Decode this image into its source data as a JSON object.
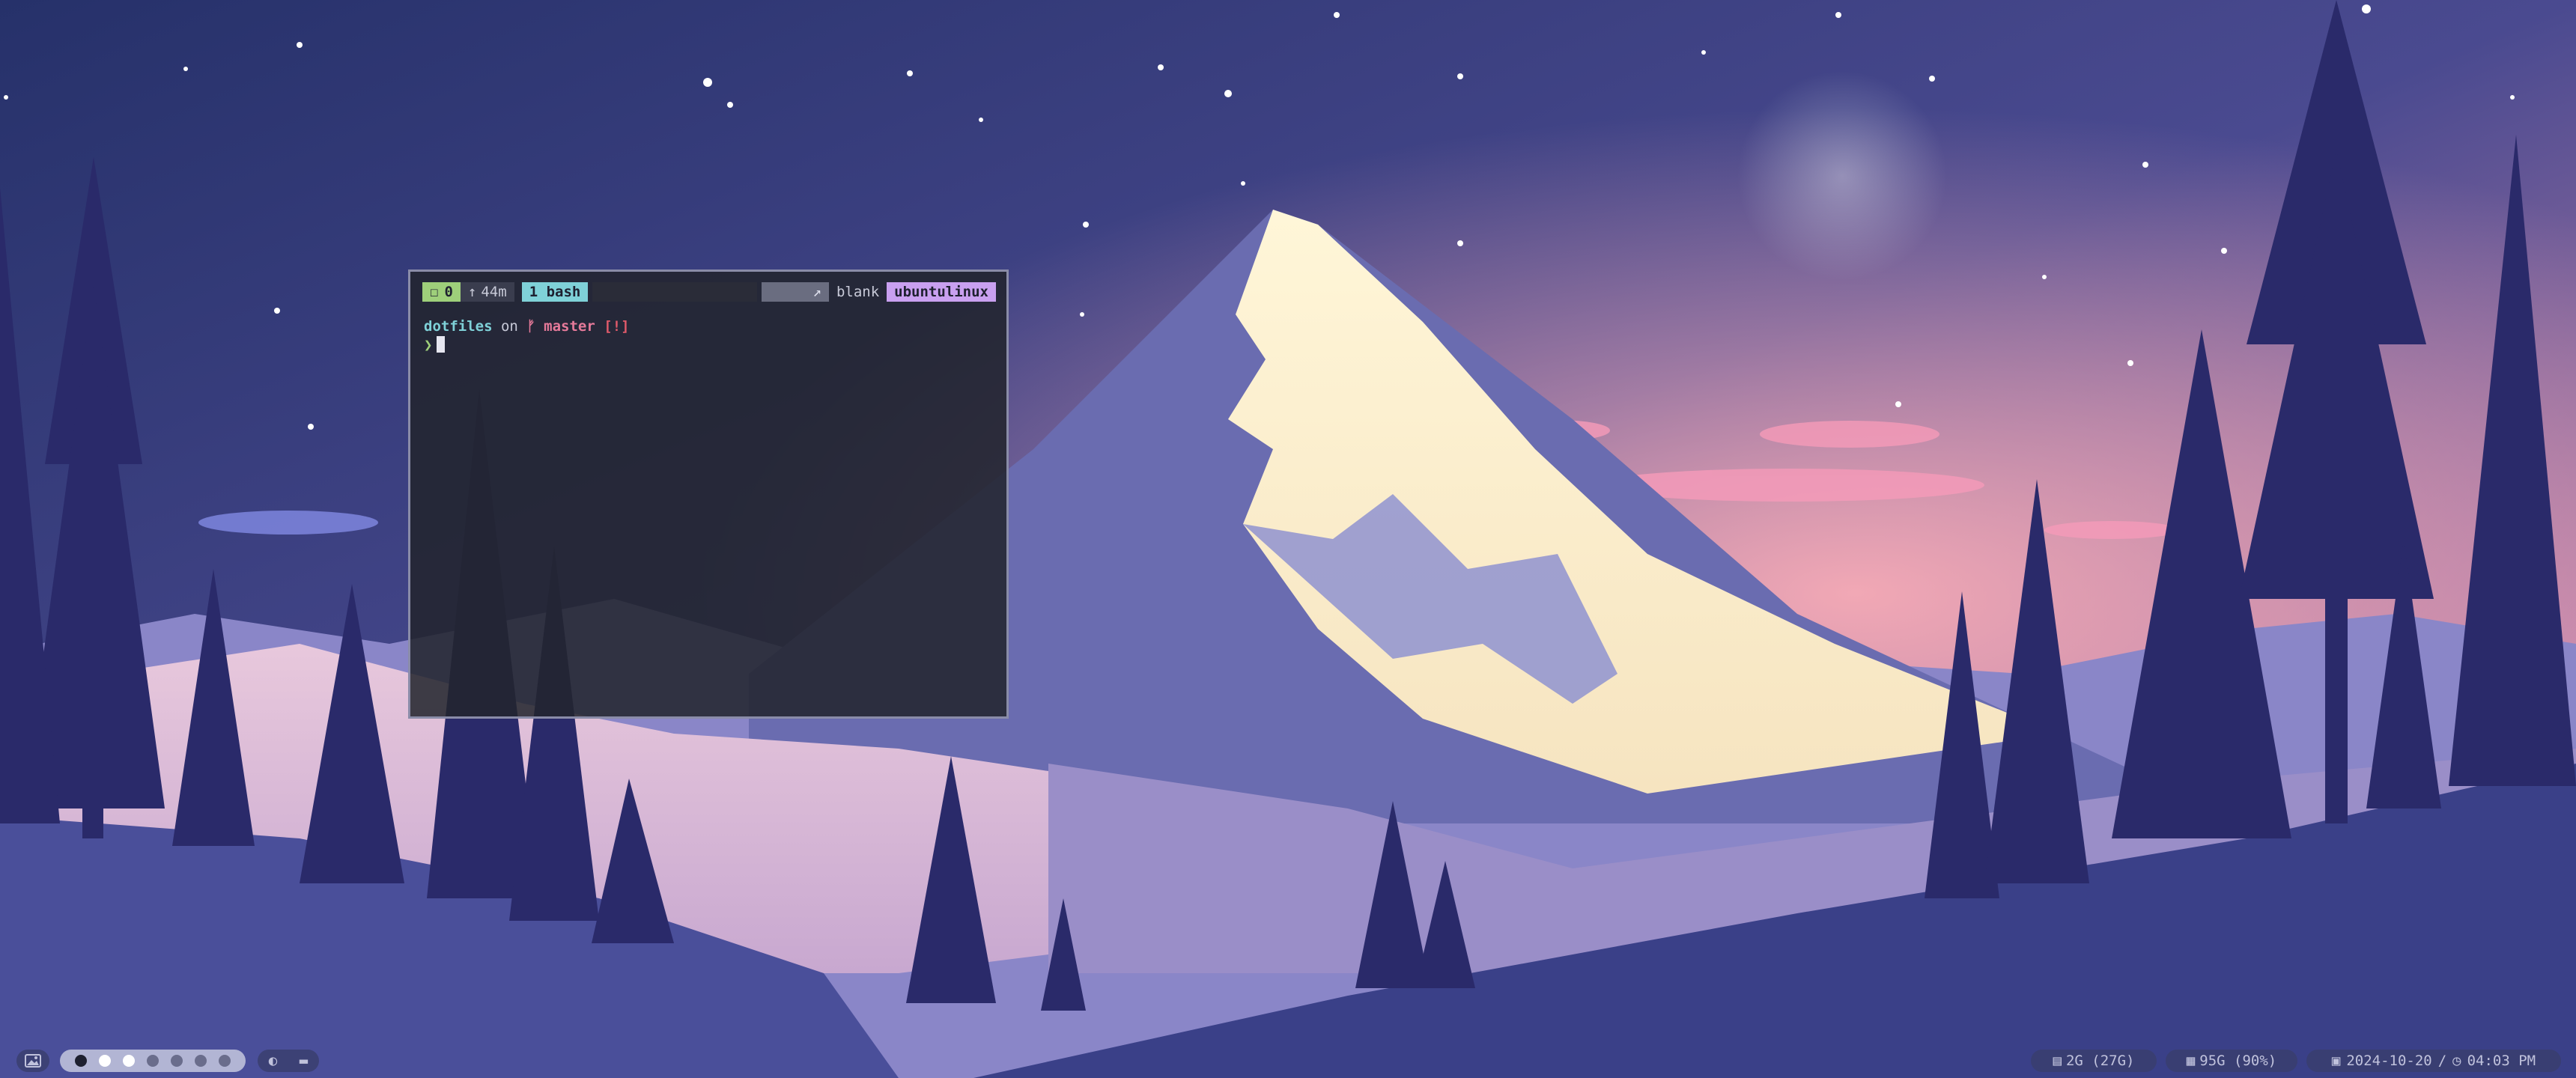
{
  "terminal": {
    "tmux": {
      "session": "0",
      "uptime": "44m",
      "window": "1 bash",
      "prefix": "",
      "mode": "blank",
      "host": "ubuntulinux"
    },
    "prompt": {
      "dir": "dotfiles",
      "on": "on",
      "branch": "master",
      "status": "[!]",
      "arrow": "❯"
    }
  },
  "bottombar": {
    "launcher_icon": "image-icon",
    "workspaces_count": 7,
    "active_workspace_index": 0,
    "tray_icons": [
      "moon-icon",
      "folder-icon"
    ],
    "ram": "2G (27G)",
    "disk": "95G (90%)",
    "date": "2024-10-20",
    "separator": "/",
    "time": "04:03 PM"
  },
  "colors": {
    "session_bg": "#9ecf7a",
    "window_bg": "#7fd1d8",
    "host_bg": "#c9a0f0",
    "branch": "#e67a9a",
    "status": "#e05a6a"
  }
}
